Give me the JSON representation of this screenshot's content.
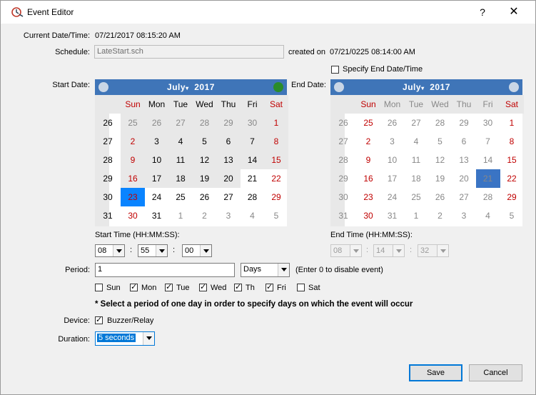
{
  "window": {
    "title": "Event Editor",
    "help": "?",
    "close": "✕"
  },
  "current": {
    "label": "Current Date/Time:",
    "value": "07/21/2017   08:15:20 AM"
  },
  "schedule": {
    "label": "Schedule:",
    "value": "LateStart.sch",
    "created_label": "created on",
    "created_value": "07/21/0225   08:14:00 AM"
  },
  "specify_end": {
    "label": "Specify End Date/Time",
    "checked": false
  },
  "start": {
    "label": "Start Date:",
    "month": "July",
    "year": "2017",
    "weekdays": [
      "Sun",
      "Mon",
      "Tue",
      "Wed",
      "Thu",
      "Fri",
      "Sat"
    ],
    "weeks": [
      "26",
      "27",
      "28",
      "29",
      "30",
      "31"
    ],
    "days": [
      [
        "25",
        "26",
        "27",
        "28",
        "29",
        "30",
        "1"
      ],
      [
        "2",
        "3",
        "4",
        "5",
        "6",
        "7",
        "8"
      ],
      [
        "9",
        "10",
        "11",
        "12",
        "13",
        "14",
        "15"
      ],
      [
        "16",
        "17",
        "18",
        "19",
        "20",
        "21",
        "22"
      ],
      [
        "23",
        "24",
        "25",
        "26",
        "27",
        "28",
        "29"
      ],
      [
        "30",
        "31",
        "1",
        "2",
        "3",
        "4",
        "5"
      ]
    ],
    "selected": "23",
    "time_label": "Start Time (HH:MM:SS):",
    "hh": "08",
    "mm": "55",
    "ss": "00"
  },
  "end": {
    "label": "End Date:",
    "month": "July",
    "year": "2017",
    "weekdays": [
      "Sun",
      "Mon",
      "Tue",
      "Wed",
      "Thu",
      "Fri",
      "Sat"
    ],
    "weeks": [
      "26",
      "27",
      "28",
      "29",
      "30",
      "31"
    ],
    "days": [
      [
        "25",
        "26",
        "27",
        "28",
        "29",
        "30",
        "1"
      ],
      [
        "2",
        "3",
        "4",
        "5",
        "6",
        "7",
        "8"
      ],
      [
        "9",
        "10",
        "11",
        "12",
        "13",
        "14",
        "15"
      ],
      [
        "16",
        "17",
        "18",
        "19",
        "20",
        "21",
        "22"
      ],
      [
        "23",
        "24",
        "25",
        "26",
        "27",
        "28",
        "29"
      ],
      [
        "30",
        "31",
        "1",
        "2",
        "3",
        "4",
        "5"
      ]
    ],
    "selected": "21",
    "time_label": "End Time (HH:MM:SS):",
    "hh": "08",
    "mm": "14",
    "ss": "32"
  },
  "period": {
    "label": "Period:",
    "value": "1",
    "unit": "Days",
    "hint": "(Enter 0 to disable event)"
  },
  "days_check": [
    {
      "label": "Sun",
      "checked": false
    },
    {
      "label": "Mon",
      "checked": true
    },
    {
      "label": "Tue",
      "checked": true
    },
    {
      "label": "Wed",
      "checked": true
    },
    {
      "label": "Th",
      "checked": true
    },
    {
      "label": "Fri",
      "checked": true
    },
    {
      "label": "Sat",
      "checked": false
    }
  ],
  "note": "* Select a period of one day in order to specify days on which the event will occur",
  "device": {
    "label": "Device:",
    "value": "Buzzer/Relay",
    "checked": true
  },
  "duration": {
    "label": "Duration:",
    "value": "5 seconds"
  },
  "buttons": {
    "save": "Save",
    "cancel": "Cancel"
  },
  "colors": {
    "calendar_header": "#3f75b8",
    "weekend_text": "#c00000",
    "selected_start": "#0a84ff",
    "selected_end": "#2f6cbf"
  }
}
